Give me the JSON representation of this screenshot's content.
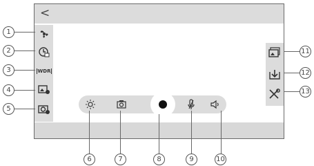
{
  "header": {
    "back_icon": "chevron-left-icon",
    "back_glyph": "<"
  },
  "left_toolbar": [
    {
      "icon": "fan-icon",
      "callout": "1"
    },
    {
      "icon": "clock-icon",
      "callout": "2"
    },
    {
      "icon": "wdr-icon",
      "label": "WDR",
      "callout": "3"
    },
    {
      "icon": "image-settings-icon",
      "callout": "4"
    },
    {
      "icon": "camera-settings-icon",
      "callout": "5"
    }
  ],
  "right_toolbar": [
    {
      "icon": "gallery-icon",
      "callout": "11"
    },
    {
      "icon": "download-icon",
      "callout": "12"
    },
    {
      "icon": "tools-icon",
      "callout": "13"
    }
  ],
  "bottom_controls": [
    {
      "icon": "brightness-icon",
      "callout": "6"
    },
    {
      "icon": "snapshot-icon",
      "callout": "7"
    },
    {
      "icon": "record-icon",
      "callout": "8"
    },
    {
      "icon": "microphone-mute-icon",
      "callout": "9"
    },
    {
      "icon": "speaker-icon",
      "callout": "10"
    }
  ]
}
